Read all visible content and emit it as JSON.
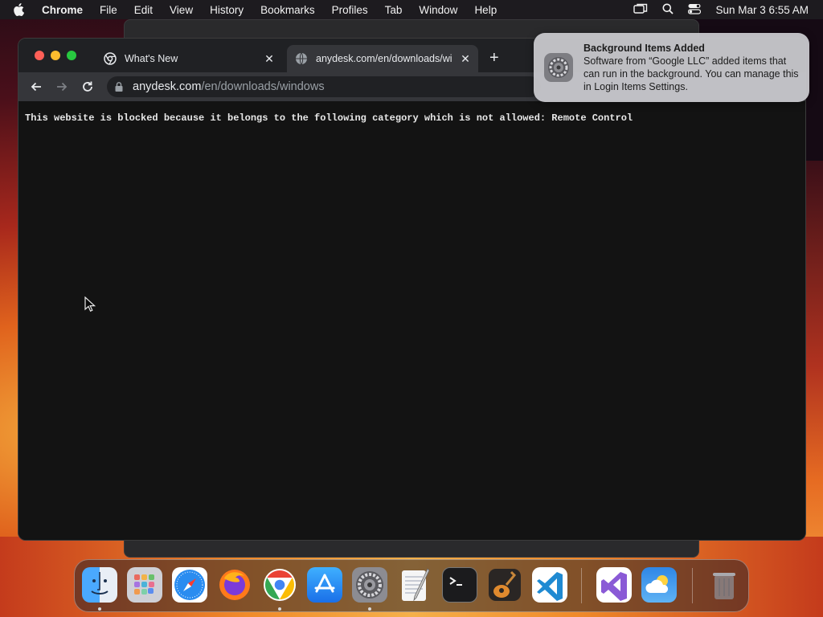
{
  "menubar": {
    "app_name": "Chrome",
    "items": [
      "File",
      "Edit",
      "View",
      "History",
      "Bookmarks",
      "Profiles",
      "Tab",
      "Window",
      "Help"
    ],
    "clock": "Sun Mar 3  6:55 AM"
  },
  "browser": {
    "tabs": [
      {
        "label": "What's New",
        "icon": "chrome-icon"
      },
      {
        "label": "anydesk.com/en/downloads/wi",
        "icon": "globe-icon"
      }
    ],
    "url_host": "anydesk.com",
    "url_path": "/en/downloads/windows",
    "content_message": "This website is blocked because it belongs to the following category which is not allowed: Remote Control"
  },
  "notification": {
    "title": "Background Items Added",
    "body": "Software from “Google LLC” added items that can run in the background. You can manage this in Login Items Settings.",
    "icon": "settings-gear-icon"
  },
  "dock": {
    "apps": [
      "Finder",
      "Launchpad",
      "Safari",
      "Firefox",
      "Chrome",
      "App Store",
      "System Settings",
      "TextEdit",
      "Terminal",
      "GarageBand",
      "Visual Studio Code",
      "Visual Studio",
      "Weather",
      "Trash"
    ]
  },
  "colors": {
    "accent_red": "#ff5f57",
    "accent_yellow": "#febc2e",
    "accent_green": "#28c840"
  }
}
